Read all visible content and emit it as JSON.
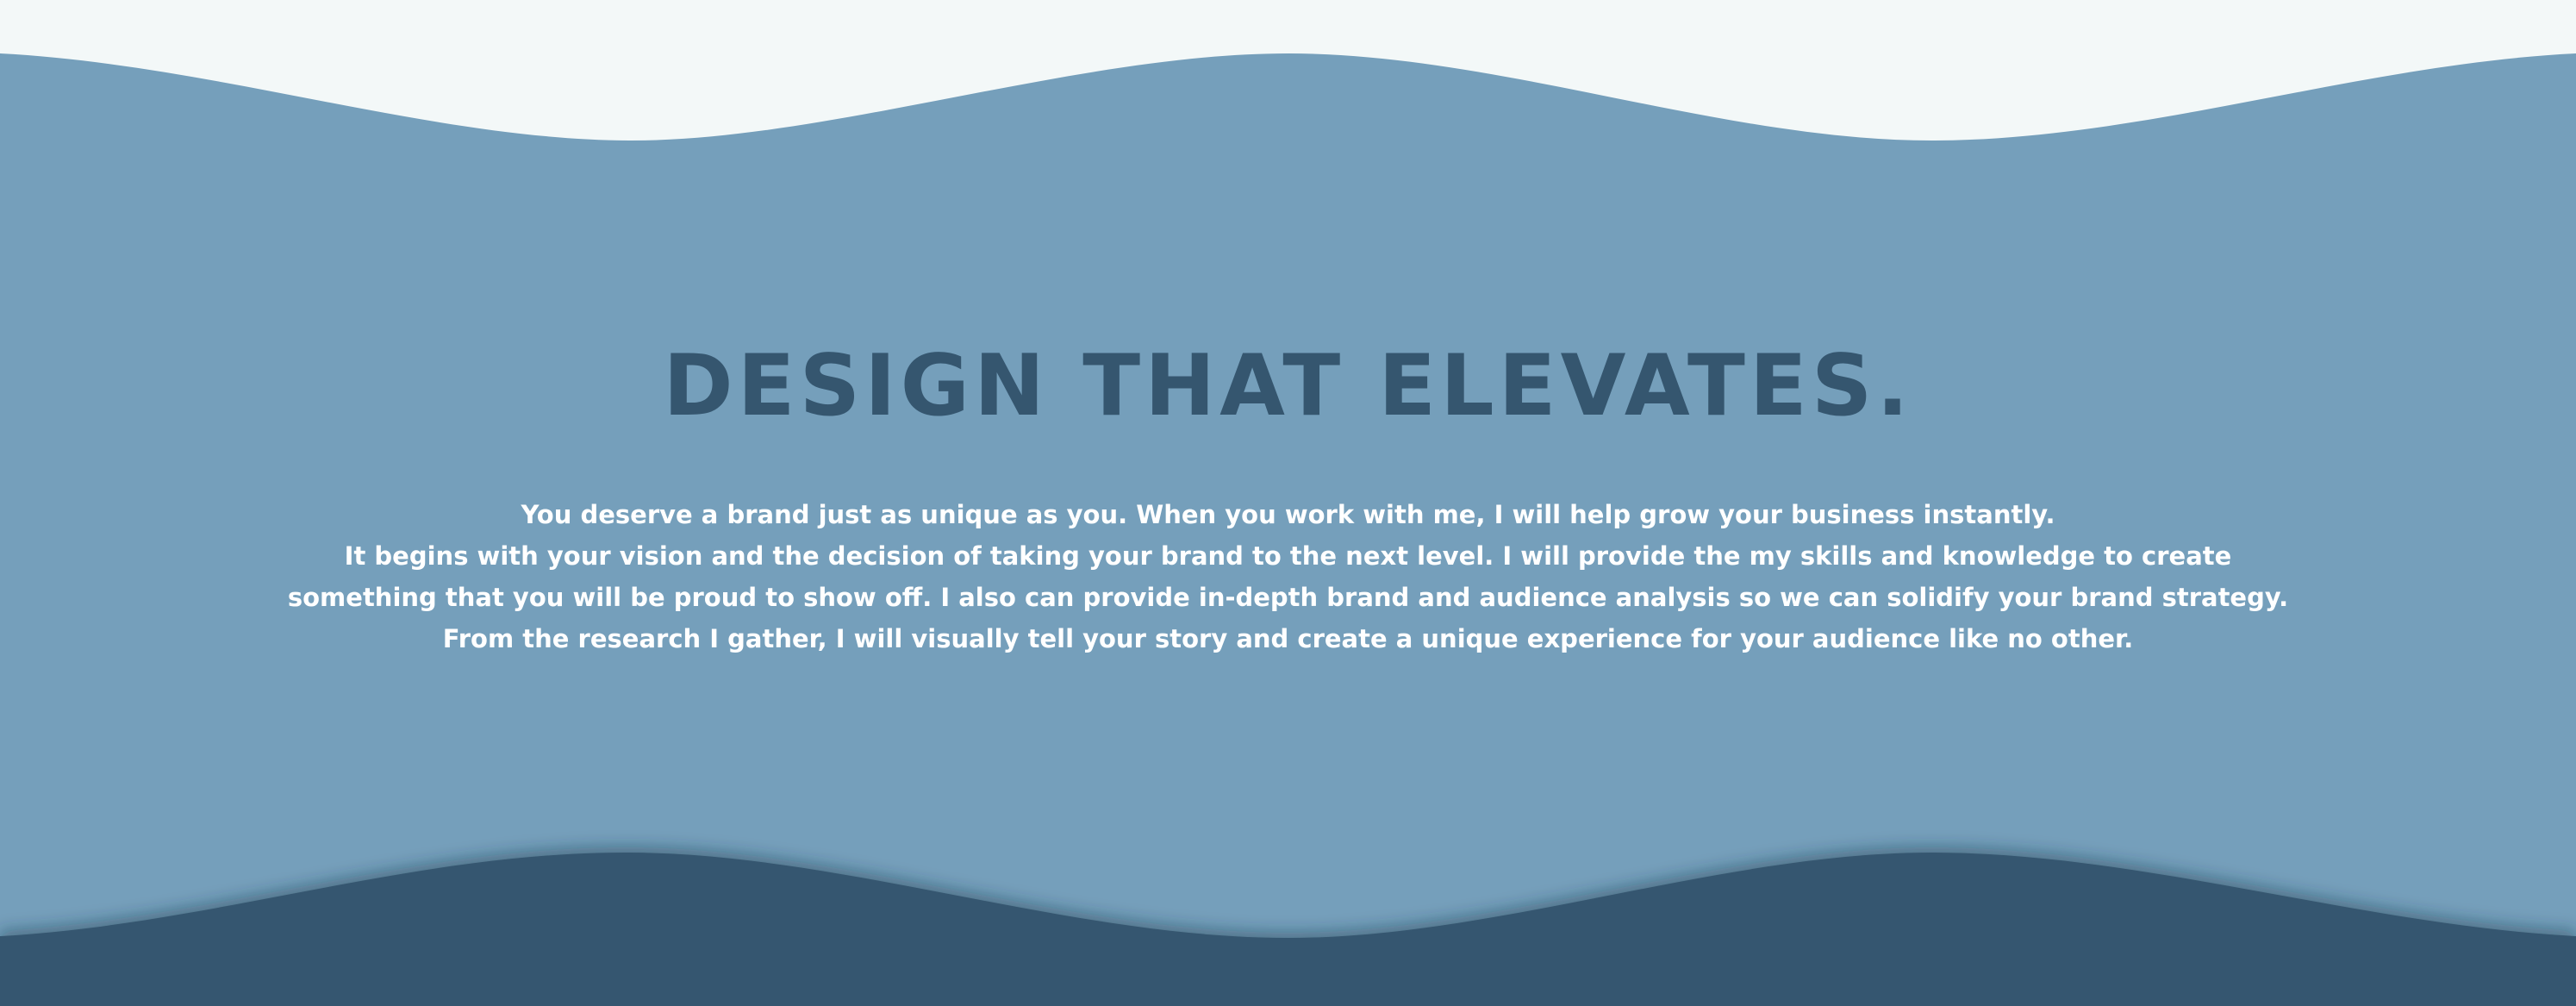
{
  "hero": {
    "headline": "DESIGN THAT ELEVATES.",
    "body_lines": [
      "You deserve a brand just as unique as you. When you work with me, I will help grow your business instantly.",
      "It begins with your vision and the decision of taking your brand to the next level. I will provide the my skills and knowledge to create",
      "something that you will be proud to show off. I also can provide in-depth brand and audience analysis so we can solidify your brand strategy.",
      "From the research I gather, I will visually tell your story and create a unique experience for your audience like no other."
    ]
  },
  "colors": {
    "page_background": "#f3f8f8",
    "hero_background": "#759fbb",
    "footer_wave": "#36576f",
    "headline": "#35566f",
    "body_text": "#ffffff"
  }
}
